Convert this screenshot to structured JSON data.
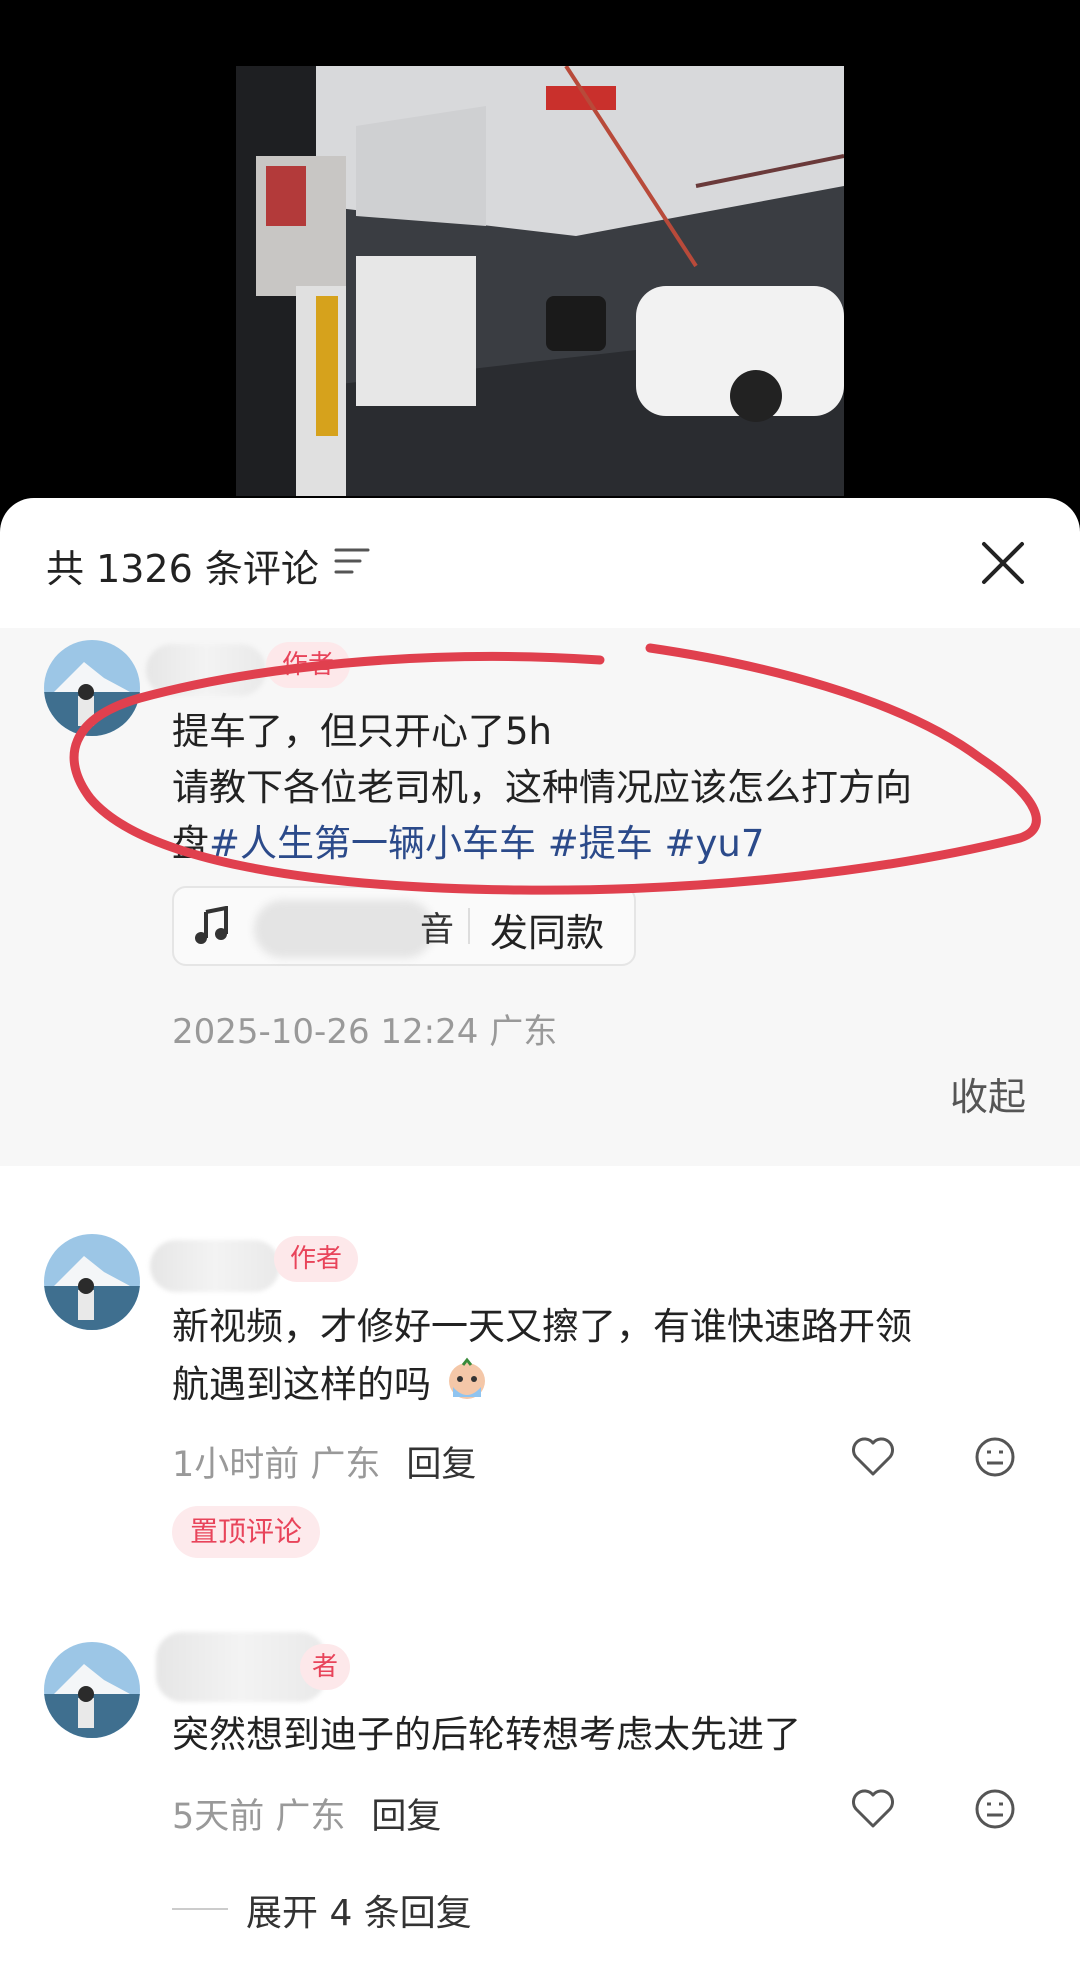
{
  "sheet": {
    "title": "共 1326 条评论"
  },
  "author_post": {
    "badge": "作者",
    "line1": "提车了，但只开心了5h",
    "line2": "请教下各位老司机，这种情况应该怎么打方向",
    "line3_plain": "盘",
    "tags": "#人生第一辆小车车 #提车 #yu7",
    "music_partial": "音",
    "music_action": "发同款",
    "timestamp": "2025-10-26 12:24 广东",
    "collapse": "收起"
  },
  "comments": [
    {
      "badge": "作者",
      "text_line1": "新视频，才修好一天又擦了，有谁快速路开领",
      "text_line2": "航遇到这样的吗",
      "time": "1小时前 广东",
      "reply": "回复",
      "pin": "置顶评论"
    },
    {
      "badge_partial": "者",
      "text": "突然想到迪子的后轮转想考虑太先进了",
      "time": "5天前 广东",
      "reply": "回复",
      "expand": "展开 4 条回复"
    }
  ],
  "icons": [
    "sort-icon",
    "close-icon",
    "music-note-icon",
    "heart-icon",
    "dislike-face-icon"
  ]
}
